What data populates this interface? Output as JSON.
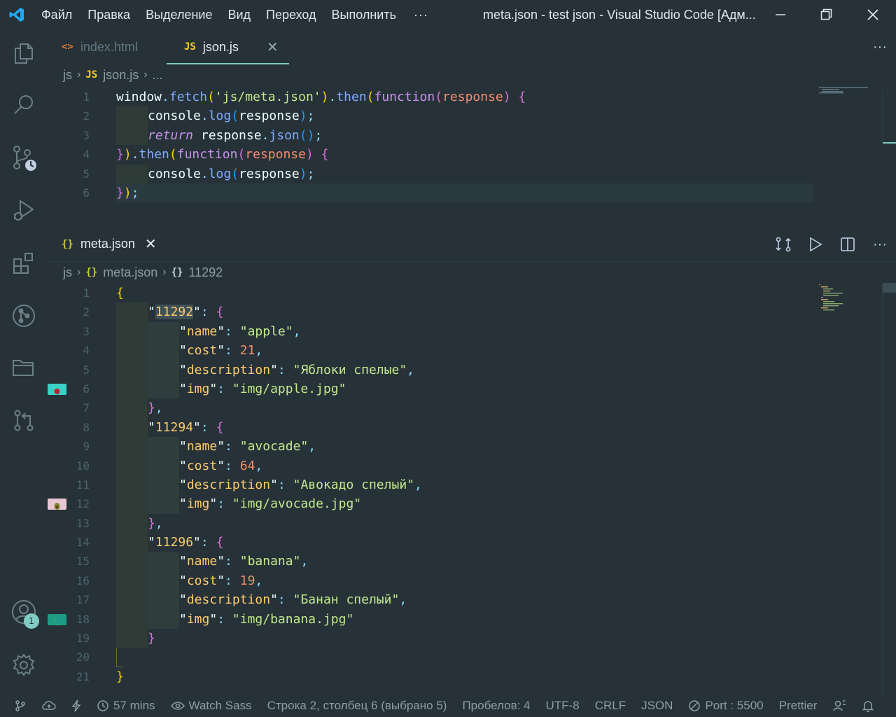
{
  "titlebar": {
    "menu": [
      "Файл",
      "Правка",
      "Выделение",
      "Вид",
      "Переход",
      "Выполнить"
    ],
    "more": "···",
    "title": "meta.json - test json - Visual Studio Code [Адм..."
  },
  "top_group": {
    "tabs": [
      {
        "icon": "<>",
        "label": "index.html"
      },
      {
        "icon": "JS",
        "label": "json.js",
        "close": "✕"
      }
    ],
    "more": "···",
    "breadcrumb": {
      "folder": "js",
      "file_icon": "JS",
      "file": "json.js",
      "tail": "..."
    },
    "line_numbers": [
      "1",
      "2",
      "3",
      "4",
      "5",
      "6"
    ]
  },
  "bottom_group": {
    "tab": {
      "icon": "{}",
      "label": "meta.json",
      "close": "✕"
    },
    "more": "···",
    "breadcrumb": {
      "folder": "js",
      "file_icon": "{}",
      "file": "meta.json",
      "symbol_icon": "{}",
      "symbol": "11292"
    },
    "line_numbers": [
      "1",
      "2",
      "3",
      "4",
      "5",
      "6",
      "7",
      "8",
      "9",
      "10",
      "11",
      "12",
      "13",
      "14",
      "15",
      "16",
      "17",
      "18",
      "19",
      "20",
      "21"
    ]
  },
  "json_items": [
    {
      "id": "11292",
      "name": "apple",
      "cost": "21",
      "description": "Яблоки спелые",
      "img": "img/apple.jpg"
    },
    {
      "id": "11294",
      "name": "avocade",
      "cost": "64",
      "description": "Авокадо спелый",
      "img": "img/avocade.jpg"
    },
    {
      "id": "11296",
      "name": "banana",
      "cost": "19",
      "description": "Банан спелый",
      "img": "img/banana.jpg"
    }
  ],
  "json_keys": {
    "name": "name",
    "cost": "cost",
    "description": "description",
    "img": "img"
  },
  "js_code": {
    "window": "window",
    "fetch": "fetch",
    "url": "'js/meta.json'",
    "then": "then",
    "function": "function",
    "response": "response",
    "console": "console",
    "log": "log",
    "return": "return",
    "json": "json"
  },
  "activity": {
    "badge": "1"
  },
  "statusbar": {
    "time": "57 mins",
    "watch": "Watch Sass",
    "position": "Строка 2, столбец 6 (выбрано 5)",
    "spaces": "Пробелов: 4",
    "encoding": "UTF-8",
    "eol": "CRLF",
    "language": "JSON",
    "port": "Port : 5500",
    "formatter": "Prettier"
  },
  "colors": {
    "accent": "#80cbc4",
    "background": "#263238",
    "key": "#ffcb6b",
    "string": "#c3e88d",
    "number": "#f78c6c"
  }
}
